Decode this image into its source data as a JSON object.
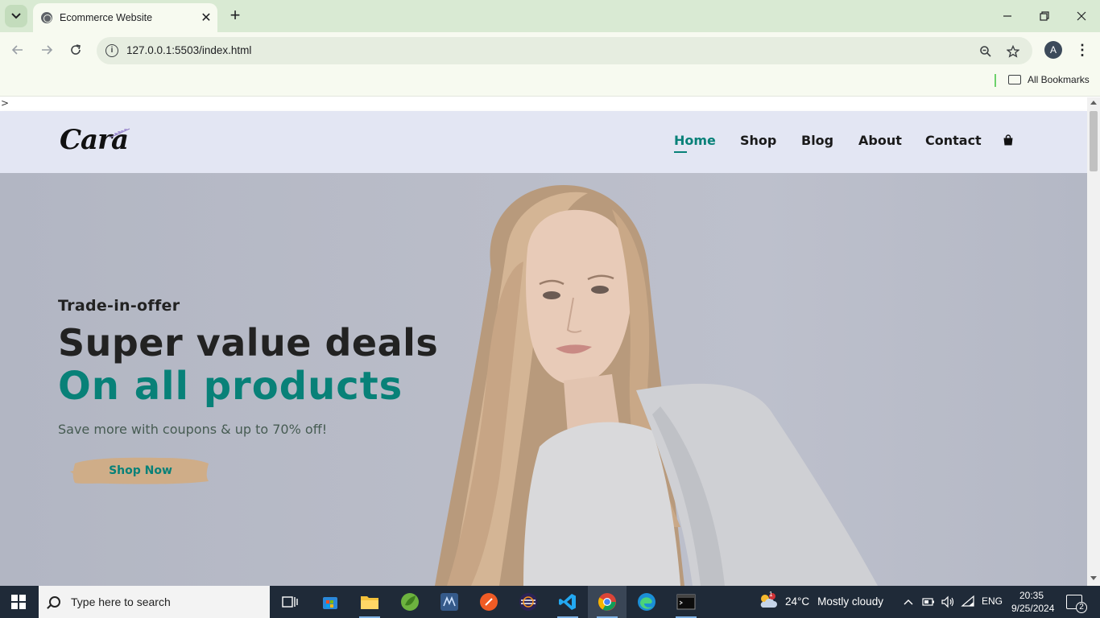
{
  "browser": {
    "tab_title": "Ecommerce Website",
    "new_tab_label": "+",
    "address": "127.0.0.1:5503/index.html",
    "profile_initial": "A",
    "bookmarks_label": "All Bookmarks"
  },
  "page": {
    "stray_text": ">",
    "logo_text": "Cara",
    "nav": {
      "items": [
        {
          "label": "Home",
          "active": true
        },
        {
          "label": "Shop",
          "active": false
        },
        {
          "label": "Blog",
          "active": false
        },
        {
          "label": "About",
          "active": false
        },
        {
          "label": "Contact",
          "active": false
        }
      ],
      "bag_icon": "shopping-bag-icon"
    },
    "hero": {
      "kicker": "Trade-in-offer",
      "headline": "Super value deals",
      "subheadline": "On all products",
      "description": "Save more with coupons & up to 70% off!",
      "button_label": "Shop Now",
      "accent_color": "#088178",
      "button_color": "#cfad88"
    }
  },
  "taskbar": {
    "search_placeholder": "Type here to search",
    "weather_temp": "24°C",
    "weather_text": "Mostly cloudy",
    "weather_badge": "1",
    "language": "ENG",
    "time": "20:35",
    "date": "9/25/2024",
    "notification_count": "2",
    "apps": [
      "task-view-icon",
      "microsoft-store-icon",
      "file-explorer-icon",
      "spring-tool-icon",
      "mysql-workbench-icon",
      "postman-icon",
      "eclipse-icon",
      "vscode-icon",
      "chrome-icon",
      "edge-icon",
      "terminal-icon"
    ]
  }
}
